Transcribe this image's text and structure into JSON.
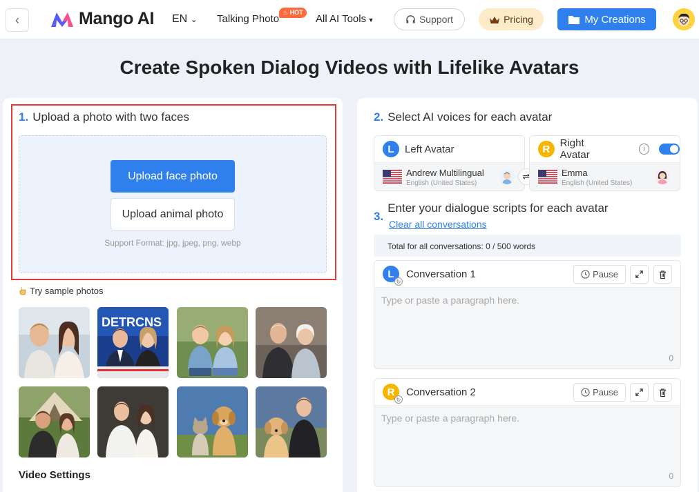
{
  "header": {
    "brand": "Mango AI",
    "language": "EN",
    "nav_talking_photo": "Talking Photo",
    "hot_badge": "HOT",
    "nav_all_tools": "All AI Tools",
    "support": "Support",
    "pricing": "Pricing",
    "my_creations": "My Creations"
  },
  "page_title": "Create Spoken Dialog Videos with Lifelike Avatars",
  "upload": {
    "step_num": "1.",
    "step_title": "Upload a photo with two faces",
    "upload_face": "Upload face photo",
    "upload_animal": "Upload animal photo",
    "format_note": "Support Format: jpg, jpeg, png, webp",
    "try_samples": "Try sample photos",
    "sample_banner": "DETRCNS"
  },
  "video_settings": "Video Settings",
  "voices": {
    "step_num": "2.",
    "step_title": "Select AI voices for each avatar",
    "left": {
      "letter": "L",
      "label": "Left Avatar",
      "voice": "Andrew Multilingual",
      "lang": "English (United States)"
    },
    "right": {
      "letter": "R",
      "label": "Right Avatar",
      "voice": "Emma",
      "lang": "English (United States)"
    },
    "swap": "⇌",
    "info": "i"
  },
  "scripts": {
    "step_num": "3.",
    "step_title": "Enter your dialogue scripts for each avatar",
    "clear_all": "Clear all conversations",
    "total": "Total for all conversations: 0 / 500 words",
    "conversations": [
      {
        "letter": "L",
        "title": "Conversation 1",
        "pause": "Pause",
        "placeholder": "Type or paste a paragraph here.",
        "count": "0"
      },
      {
        "letter": "R",
        "title": "Conversation 2",
        "pause": "Pause",
        "placeholder": "Type or paste a paragraph here.",
        "count": "0"
      }
    ]
  },
  "colors": {
    "accent": "#2f80ed",
    "left_badge": "#2f80ed",
    "right_badge": "#f7b500",
    "highlight_border": "#e53935",
    "hot": "#ff6a3d"
  }
}
